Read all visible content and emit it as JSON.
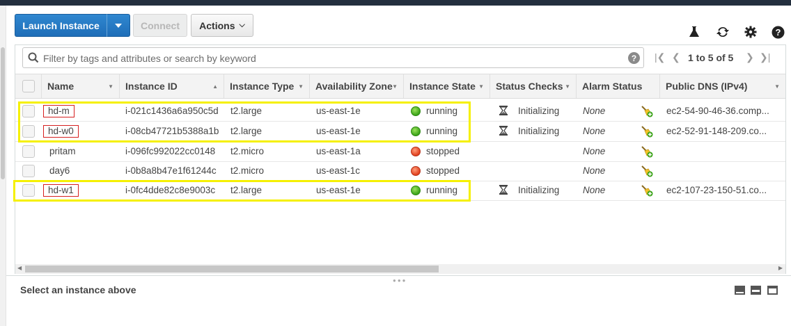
{
  "toolbar": {
    "launch_label": "Launch Instance",
    "connect_label": "Connect",
    "actions_label": "Actions",
    "icons": [
      "flask-icon",
      "refresh-icon",
      "gear-icon",
      "help-icon"
    ]
  },
  "search": {
    "placeholder": "Filter by tags and attributes or search by keyword",
    "help_glyph": "?"
  },
  "pagination": {
    "text": "1 to 5 of 5"
  },
  "columns": [
    "Name",
    "Instance ID",
    "Instance Type",
    "Availability Zone",
    "Instance State",
    "Status Checks",
    "Alarm Status",
    "Public DNS (IPv4)"
  ],
  "instances": [
    {
      "name": "hd-m",
      "id": "i-021c1436a6a950c5d",
      "type": "t2.large",
      "zone": "us-east-1e",
      "state": "running",
      "status": "Initializing",
      "alarm": "None",
      "dns": "ec2-54-90-46-36.comp..."
    },
    {
      "name": "hd-w0",
      "id": "i-08cb47721b5388a1b",
      "type": "t2.large",
      "zone": "us-east-1e",
      "state": "running",
      "status": "Initializing",
      "alarm": "None",
      "dns": "ec2-52-91-148-209.co..."
    },
    {
      "name": "pritam",
      "id": "i-096fc992022cc0148",
      "type": "t2.micro",
      "zone": "us-east-1a",
      "state": "stopped",
      "status": "",
      "alarm": "None",
      "dns": ""
    },
    {
      "name": "day6",
      "id": "i-0b8a8b47e1f61244c",
      "type": "t2.micro",
      "zone": "us-east-1c",
      "state": "stopped",
      "status": "",
      "alarm": "None",
      "dns": ""
    },
    {
      "name": "hd-w1",
      "id": "i-0fc4dde82c8e9003c",
      "type": "t2.large",
      "zone": "us-east-1e",
      "state": "running",
      "status": "Initializing",
      "alarm": "None",
      "dns": "ec2-107-23-150-51.co..."
    }
  ],
  "details": {
    "message": "Select an instance above"
  },
  "colors": {
    "running": "#3aa218",
    "stopped": "#e0401e",
    "highlight": "#f5f000",
    "name_box": "#d61f1f",
    "primary": "#1f6eb8"
  }
}
